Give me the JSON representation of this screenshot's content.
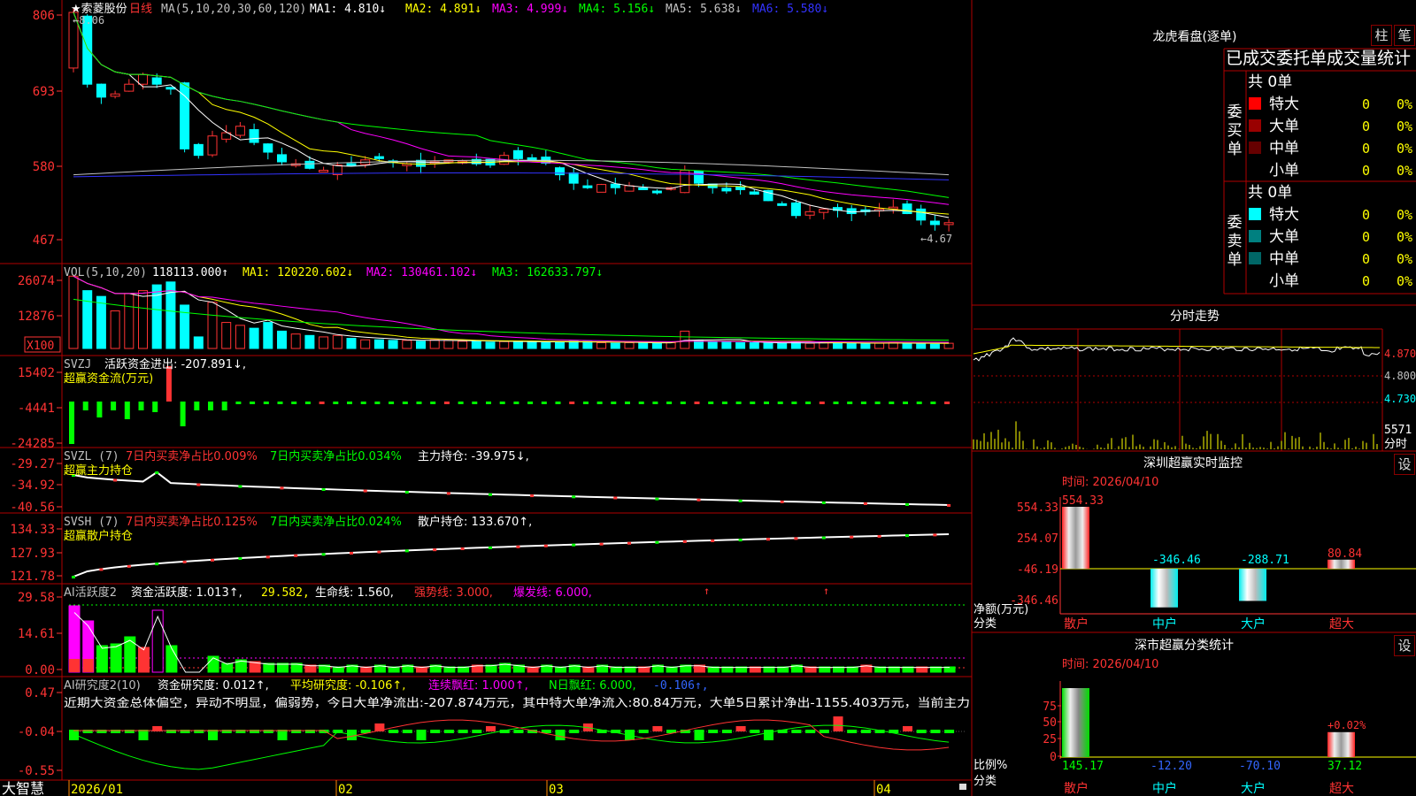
{
  "app_logo": "大智慧",
  "main_chart": {
    "stock_name": "★索菱股份",
    "period": "日线",
    "ma_label": "MA(5,10,20,30,60,120)",
    "ma": [
      {
        "label": "MA1: 4.810↓",
        "color": "#ffffff"
      },
      {
        "label": "MA2: 4.891↓",
        "color": "#ffff00"
      },
      {
        "label": "MA3: 4.999↓",
        "color": "#ff00ff"
      },
      {
        "label": "MA4: 5.156↓",
        "color": "#00ff00"
      },
      {
        "label": "MA5: 5.638↓",
        "color": "#c0c0c0"
      },
      {
        "label": "MA6: 5.580↓",
        "color": "#3333ff"
      }
    ],
    "y_ticks": [
      "806",
      "693",
      "580",
      "467"
    ],
    "high_label": "8.06",
    "low_label": "4.67"
  },
  "vol": {
    "label": "VOL(5,10,20)",
    "values": [
      {
        "label": "118113.000↑",
        "color": "#ffffff"
      },
      {
        "label": "MA1: 120220.602↓",
        "color": "#ffff00"
      },
      {
        "label": "MA2: 130461.102↓",
        "color": "#ff00ff"
      },
      {
        "label": "MA3: 162633.797↓",
        "color": "#00ff00"
      }
    ],
    "y_ticks": [
      "26074",
      "12876"
    ],
    "unit": "X100"
  },
  "svzj": {
    "label": "SVZJ",
    "text1": "活跃资金进出: -207.891↓,",
    "subtitle": "超赢资金流(万元)",
    "y_ticks": [
      "15402",
      "-4441",
      "-24285"
    ]
  },
  "svzl": {
    "label": "SVZL (7)",
    "t1": "7日内买卖净占比0.009%",
    "t2": "7日内买卖净占比0.034%",
    "t3": "主力持仓: -39.975↓,",
    "subtitle": "超赢主力持仓",
    "y_ticks": [
      "-29.27",
      "-34.92",
      "-40.56"
    ]
  },
  "svsh": {
    "label": "SVSH (7)",
    "t1": "7日内买卖净占比0.125%",
    "t2": "7日内买卖净占比0.024%",
    "t3": "散户持仓: 133.670↑,",
    "subtitle": "超赢散户持仓",
    "y_ticks": [
      "134.33",
      "127.93",
      "121.78"
    ]
  },
  "ai_active": {
    "label": "AI活跃度2",
    "t1": "资金活跃度: 1.013↑,",
    "t2": "29.582,",
    "t3": "生命线: 1.560,",
    "t4": "强势线: 3.000,",
    "t5": "爆发线: 6.000,",
    "y_ticks": [
      "29.58",
      "14.61",
      "0.00"
    ]
  },
  "ai_research": {
    "label": "AI研究度2(10)",
    "t1": "资金研究度: 0.012↑,",
    "t2": "平均研究度: -0.106↑,",
    "t3": "连续飘红: 1.000↑,",
    "t4": "N日飘红: 6.000,",
    "t5": "-0.106↑,",
    "comment": "近期大资金总体偏空，异动不明显，偏弱势，今日大单净流出:-207.874万元，其中特大单净流入:80.84万元，大单5日累计净出-1155.403万元，当前主力",
    "y_ticks": [
      "0.47",
      "-0.04",
      "-0.55"
    ]
  },
  "x_axis": [
    "2026/01",
    "02",
    "03",
    "04"
  ],
  "dragon_tiger": {
    "title": "龙虎看盘(逐单)",
    "btn_bar": "柱",
    "btn_pen": "笔",
    "table_title": "已成交委托单成交量统计",
    "buy": {
      "side": "委买单",
      "total": "共 0单",
      "rows": [
        {
          "label": "特大",
          "count": "0",
          "pct": "0%",
          "color": "#ff0000"
        },
        {
          "label": "大单",
          "count": "0",
          "pct": "0%",
          "color": "#990000"
        },
        {
          "label": "中单",
          "count": "0",
          "pct": "0%",
          "color": "#660000"
        },
        {
          "label": "小单",
          "count": "0",
          "pct": "0%",
          "color": ""
        }
      ]
    },
    "sell": {
      "side": "委卖单",
      "total": "共 0单",
      "rows": [
        {
          "label": "特大",
          "count": "0",
          "pct": "0%",
          "color": "#00ffff"
        },
        {
          "label": "大单",
          "count": "0",
          "pct": "0%",
          "color": "#008080"
        },
        {
          "label": "中单",
          "count": "0",
          "pct": "0%",
          "color": "#006666"
        },
        {
          "label": "小单",
          "count": "0",
          "pct": "0%",
          "color": ""
        }
      ]
    }
  },
  "intraday": {
    "title": "分时走势",
    "y_ticks": [
      "4.870",
      "4.800",
      "4.730"
    ],
    "vol_top": "5571",
    "vol_bottom": "分时"
  },
  "sz_monitor": {
    "title": "深圳超赢实时监控",
    "btn": "设",
    "time": "时间: 2026/04/10",
    "y_ticks": [
      "554.33",
      "254.07",
      "-46.19",
      "-346.46"
    ],
    "axis_label_1": "净额(万元)",
    "axis_label_2": "分类",
    "bars": [
      {
        "cat": "散户",
        "value": 554.33,
        "label": "554.33"
      },
      {
        "cat": "中户",
        "value": -346.46,
        "label": "-346.46"
      },
      {
        "cat": "大户",
        "value": -288.71,
        "label": "-288.71"
      },
      {
        "cat": "超大",
        "value": 80.84,
        "label": "80.84"
      }
    ]
  },
  "sz_classify": {
    "title": "深市超赢分类统计",
    "btn": "设",
    "time": "时间: 2026/04/10",
    "y_ticks": [
      "75",
      "50",
      "25",
      "0"
    ],
    "axis_label_1": "比例%",
    "axis_label_2": "分类",
    "bars": [
      {
        "cat": "散户",
        "value": 145.17,
        "label": "145.17"
      },
      {
        "cat": "中户",
        "value": -12.2,
        "label": "-12.20"
      },
      {
        "cat": "大户",
        "value": -70.1,
        "label": "-70.10"
      },
      {
        "cat": "超大",
        "value": 37.12,
        "label": "37.12"
      }
    ],
    "extra_label": "+0.02%"
  }
}
